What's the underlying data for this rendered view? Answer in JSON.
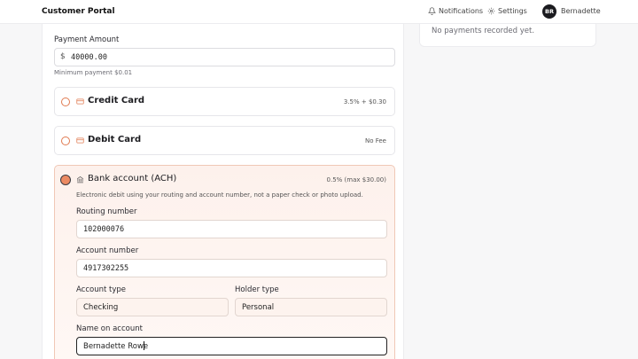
{
  "header": {
    "brand": "Customer Portal",
    "notifications_label": "Notifications",
    "settings_label": "Settings",
    "user_initials": "BR",
    "user_name": "Bernadette"
  },
  "payment": {
    "amount_label": "Payment Amount",
    "currency_symbol": "$",
    "amount_value": "40000.00",
    "amount_hint": "Minimum payment $0.01"
  },
  "methods": [
    {
      "key": "credit",
      "title": "Credit Card",
      "fee": "3.5% + $0.30",
      "selected": false,
      "icon": "credit-card-icon"
    },
    {
      "key": "debit",
      "title": "Debit Card",
      "fee": "No Fee",
      "selected": false,
      "icon": "credit-card-icon"
    },
    {
      "key": "ach",
      "title": "Bank account (ACH)",
      "fee": "0.5% (max $30.00)",
      "selected": true,
      "icon": "bank-icon"
    }
  ],
  "bank": {
    "description": "Electronic debit using your routing and account number, not a paper check or photo upload.",
    "routing_label": "Routing number",
    "routing_value": "102000076",
    "account_label": "Account number",
    "account_value": "4917302255",
    "account_type_label": "Account type",
    "account_type_value": "Checking",
    "holder_type_label": "Holder type",
    "holder_type_value": "Personal",
    "name_label": "Name on account",
    "name_value": "Bernadette Rowe"
  },
  "sidebar": {
    "empty_text": "No payments recorded yet."
  },
  "colors": {
    "accent": "#e07a50",
    "selected_bg": "#fdf1ec",
    "selected_border": "#f0c8b6"
  }
}
